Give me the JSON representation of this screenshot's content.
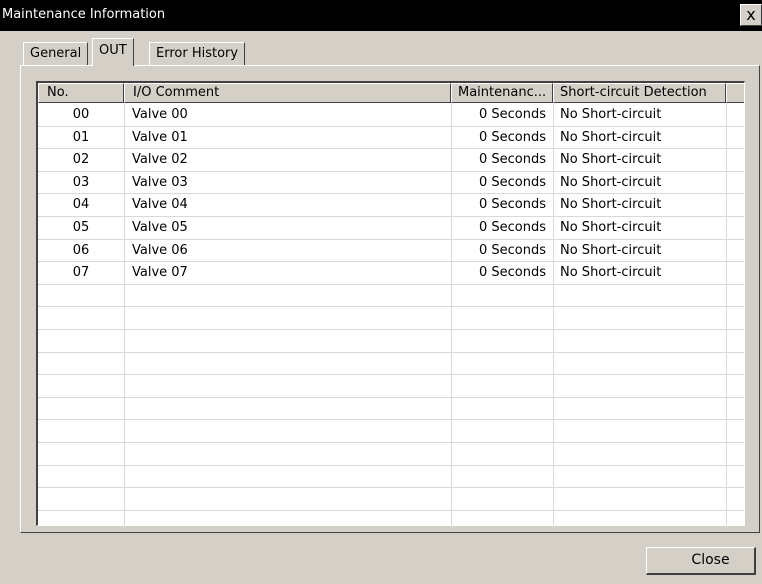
{
  "window": {
    "title": "Maintenance Information",
    "close_glyph": "x"
  },
  "tabs": [
    {
      "label": "General"
    },
    {
      "label": "OUT"
    },
    {
      "label": "Error History"
    }
  ],
  "table": {
    "columns": [
      "No.",
      "I/O Comment",
      "Maintenanc...",
      "Short-circuit Detection"
    ],
    "rows": [
      [
        "00",
        "Valve 00",
        "0 Seconds",
        "No Short-circuit"
      ],
      [
        "01",
        "Valve 01",
        "0 Seconds",
        "No Short-circuit"
      ],
      [
        "02",
        "Valve 02",
        "0 Seconds",
        "No Short-circuit"
      ],
      [
        "03",
        "Valve 03",
        "0 Seconds",
        "No Short-circuit"
      ],
      [
        "04",
        "Valve 04",
        "0 Seconds",
        "No Short-circuit"
      ],
      [
        "05",
        "Valve 05",
        "0 Seconds",
        "No Short-circuit"
      ],
      [
        "06",
        "Valve 06",
        "0 Seconds",
        "No Short-circuit"
      ],
      [
        "07",
        "Valve 07",
        "0 Seconds",
        "No Short-circuit"
      ]
    ]
  },
  "buttons": {
    "close_label": "Close"
  }
}
